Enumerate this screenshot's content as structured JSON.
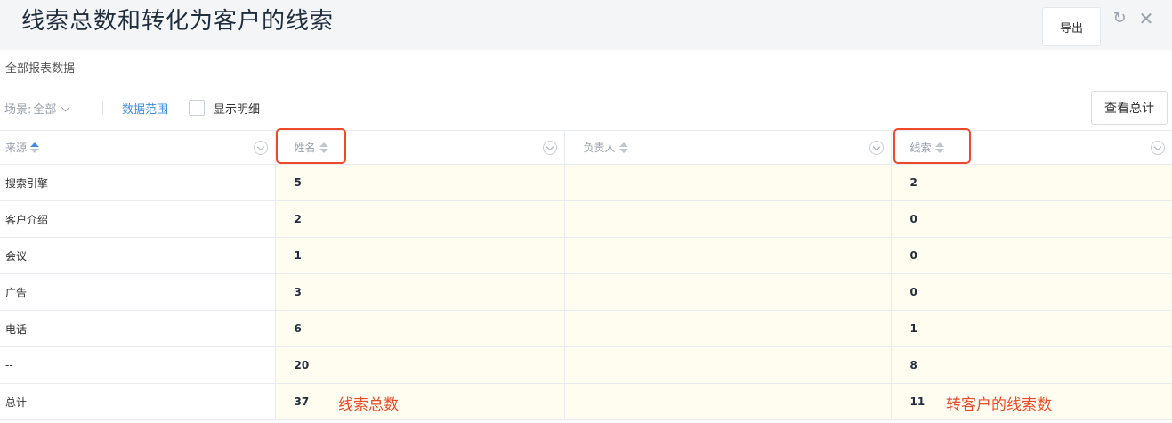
{
  "header": {
    "title": "线索总数和转化为客户的线索",
    "export_label": "导出"
  },
  "subheader": {
    "label": "全部报表数据"
  },
  "toolbar": {
    "scene_label": "场景:",
    "scene_value": "全部",
    "range_label": "数据范围",
    "show_detail_label": "显示明细",
    "view_total_label": "查看总计"
  },
  "table": {
    "columns": [
      {
        "label": "来源"
      },
      {
        "label": "姓名"
      },
      {
        "label": "负责人"
      },
      {
        "label": "线索"
      }
    ],
    "rows": [
      {
        "source": "搜索引擎",
        "name_count": "5",
        "owner": "",
        "leads": "2"
      },
      {
        "source": "客户介绍",
        "name_count": "2",
        "owner": "",
        "leads": "0"
      },
      {
        "source": "会议",
        "name_count": "1",
        "owner": "",
        "leads": "0"
      },
      {
        "source": "广告",
        "name_count": "3",
        "owner": "",
        "leads": "0"
      },
      {
        "source": "电话",
        "name_count": "6",
        "owner": "",
        "leads": "1"
      },
      {
        "source": "--",
        "name_count": "20",
        "owner": "",
        "leads": "8"
      },
      {
        "source": "总计",
        "name_count": "37",
        "owner": "",
        "leads": "11"
      }
    ]
  },
  "annotations": {
    "total_leads": "线索总数",
    "converted_leads": "转客户的线索数",
    "color": "#ee4a2a"
  },
  "colors": {
    "accent": "#3d8de2",
    "header_bg": "#f4f5f7",
    "value_bg": "#fffdf0"
  }
}
